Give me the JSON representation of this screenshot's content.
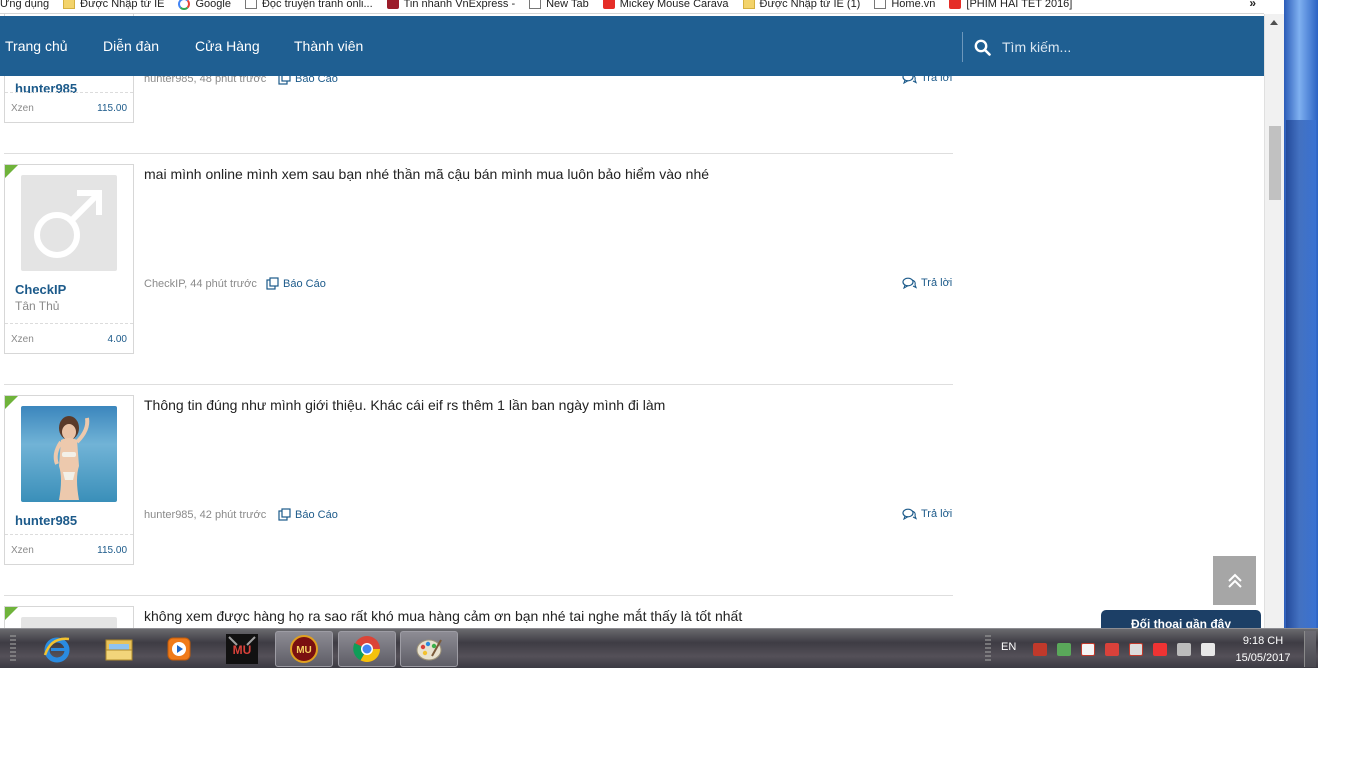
{
  "bookmarks": [
    {
      "label": "Ứng dụng",
      "icon": "apps-icon"
    },
    {
      "label": "Được Nhập từ IE",
      "icon": "folder-icon"
    },
    {
      "label": "Google",
      "icon": "google-icon"
    },
    {
      "label": "Đọc truyện tranh onli...",
      "icon": "page-icon"
    },
    {
      "label": "Tin nhanh VnExpress -",
      "icon": "vnexpress-icon"
    },
    {
      "label": "New Tab",
      "icon": "page-icon"
    },
    {
      "label": "Mickey Mouse Carava",
      "icon": "youtube-icon"
    },
    {
      "label": "Được Nhập từ IE (1)",
      "icon": "folder-icon"
    },
    {
      "label": "Home.vn",
      "icon": "page-icon"
    },
    {
      "label": "[PHIM HÀI TẾT 2016]",
      "icon": "youtube-icon"
    }
  ],
  "bookmarks_more": "»",
  "nav": {
    "home": "Trang chủ",
    "forum": "Diễn đàn",
    "store": "Cửa Hàng",
    "members": "Thành viên",
    "search_placeholder": "Tìm kiếm..."
  },
  "posts": [
    {
      "username": "hunter985",
      "usertitle": "",
      "stat_label": "Xzen",
      "stat_value": "115.00",
      "message": "",
      "meta": "hunter985, 48 phút trước",
      "report": "Báo Cáo",
      "reply": "Trả lời"
    },
    {
      "username": "CheckIP",
      "usertitle": "Tân Thủ",
      "stat_label": "Xzen",
      "stat_value": "4.00",
      "message": "mai mình online mình xem sau bạn nhé thần mã cậu bán mình mua luôn bảo hiểm vào nhé",
      "meta": "CheckIP, 44 phút trước",
      "report": "Báo Cáo",
      "reply": "Trả lời"
    },
    {
      "username": "hunter985",
      "usertitle": "",
      "stat_label": "Xzen",
      "stat_value": "115.00",
      "message": "Thông tin đúng như mình giới thiệu. Khác cái eif rs thêm 1 lần ban ngày mình đi làm",
      "meta": "hunter985, 42 phút trước",
      "report": "Báo Cáo",
      "reply": "Trả lời"
    },
    {
      "message": "không xem được hàng họ ra sao rất khó mua hàng cảm ơn bạn nhé tai nghe mắt thấy là tốt nhất"
    }
  ],
  "recent_conversations": "Đối thoại gần đây",
  "taskbar": {
    "apps": [
      "internet-explorer-icon",
      "file-explorer-icon",
      "media-player-icon",
      "mu-game-icon",
      "mu-launcher-icon",
      "chrome-icon",
      "paint-icon"
    ],
    "language": "EN",
    "time": "9:18 CH",
    "date": "15/05/2017"
  },
  "colors": {
    "nav_bg": "#1f5f92",
    "link": "#1c5a8a",
    "accent_corner": "#6fb33b",
    "recent_tab_bg": "#1c3f66"
  }
}
